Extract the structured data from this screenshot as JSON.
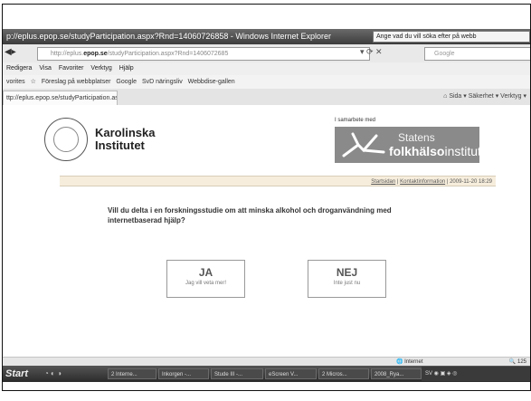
{
  "window": {
    "title": "p://eplus.epop.se/studyParticipation.aspx?Rnd=14060726858 - Windows Internet Explorer",
    "tooltip": "Ange vad du vill söka efter på webb"
  },
  "address": {
    "url_prefix": "http://eplus.",
    "url_domain": "epop.se",
    "url_rest": "/studyParticipation.aspx?Rnd=1406072685",
    "search_placeholder": "Google"
  },
  "menu": [
    "Redigera",
    "Visa",
    "Favoriter",
    "Verktyg",
    "Hjälp"
  ],
  "favorites": {
    "label": "vorites",
    "items": [
      "Föreslag på webbplatser",
      "Google",
      "SvD näringsliv",
      "Webbdise-gallen"
    ]
  },
  "tab": {
    "label": "ttp://eplus.epop.se/studyParticipation.asp..."
  },
  "commandbar": {
    "items": [
      "Sida",
      "Säkerhet",
      "Verktyg"
    ]
  },
  "logos": {
    "ki_line1": "Karolinska",
    "ki_line2": "Institutet",
    "partner_label": "I samarbete med",
    "sfi_line1": "Statens",
    "sfi_line2_bold": "folkhälso",
    "sfi_line2_rest": "institut"
  },
  "infobar": {
    "start": "Startsidan",
    "contact": "Kontaktinformation",
    "datetime": "2009-11-20 18:29"
  },
  "question": "Vill du delta i en forskningsstudie om att minska alkohol och droganvändning med internetbaserad hjälp?",
  "choices": {
    "yes_label": "JA",
    "yes_sub": "Jag vill veta mer!",
    "no_label": "NEJ",
    "no_sub": "Inte just nu"
  },
  "status": {
    "zone": "Internet",
    "zoom": "125"
  },
  "taskbar": {
    "start": "Start",
    "tasks": [
      "2 Interne...",
      "Inkorgen -...",
      "Stude III -...",
      "eScreen V...",
      "2 Micros...",
      "2008_Rya..."
    ],
    "tray": "SV"
  }
}
